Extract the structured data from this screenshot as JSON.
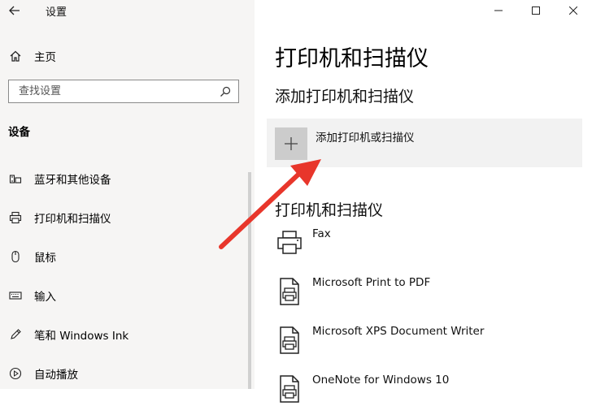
{
  "app": {
    "title": "设置"
  },
  "sidebar": {
    "home_label": "主页",
    "search_placeholder": "查找设置",
    "section_label": "设备",
    "items": [
      {
        "label": "蓝牙和其他设备",
        "icon": "bluetooth-devices-icon"
      },
      {
        "label": "打印机和扫描仪",
        "icon": "printer-icon"
      },
      {
        "label": "鼠标",
        "icon": "mouse-icon"
      },
      {
        "label": "输入",
        "icon": "keyboard-icon"
      },
      {
        "label": "笔和 Windows Ink",
        "icon": "pen-icon"
      },
      {
        "label": "自动播放",
        "icon": "autoplay-icon"
      }
    ]
  },
  "main": {
    "title": "打印机和扫描仪",
    "add_section_heading": "添加打印机和扫描仪",
    "add_button_label": "添加打印机或扫描仪",
    "list_heading": "打印机和扫描仪",
    "printers": [
      {
        "name": "Fax",
        "icon": "fax-icon"
      },
      {
        "name": "Microsoft Print to PDF",
        "icon": "document-printer-icon"
      },
      {
        "name": "Microsoft XPS Document Writer",
        "icon": "document-printer-icon"
      },
      {
        "name": "OneNote for Windows 10",
        "icon": "document-printer-icon"
      }
    ]
  },
  "colors": {
    "sidebar_bg": "#f6f5f4",
    "tile_bg": "#f2f2f2",
    "plus_box": "#cccccc",
    "annotation_arrow": "#e8362b"
  }
}
